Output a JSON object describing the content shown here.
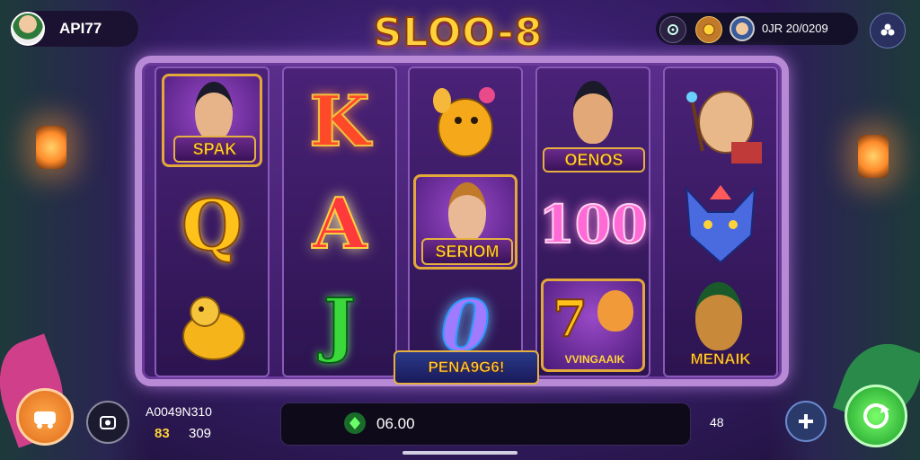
{
  "player": {
    "name": "API77"
  },
  "game": {
    "title": "SLOO-8"
  },
  "header": {
    "balance": "0JR 20/0209"
  },
  "reels": [
    {
      "symbols": [
        "SPAK",
        "Q",
        "golden-seahorse"
      ]
    },
    {
      "symbols": [
        "K",
        "A",
        "J"
      ]
    },
    {
      "symbols": [
        "golden-deer",
        "SERIOM",
        "0"
      ]
    },
    {
      "symbols": [
        "OENOS",
        "100",
        "VVINGAAIK"
      ]
    },
    {
      "symbols": [
        "lion-wizard",
        "rainbow-wolf",
        "MENAIK"
      ]
    }
  ],
  "labels": {
    "spak": "SPAK",
    "oenos": "OENOS",
    "seriom": "SERIOM",
    "menaik": "MENAIK",
    "vvingaaik": "VVINGAAIK",
    "pena": "PENA9G6!"
  },
  "letters": {
    "k": "K",
    "q": "Q",
    "a": "A",
    "j": "J",
    "zero": "0",
    "hundred": "100",
    "seven": "7"
  },
  "footer": {
    "account_code": "A0049N310",
    "stat_a": "83",
    "stat_b": "309",
    "bet_value": "06.00",
    "right_value": "48"
  },
  "icons": {
    "settings": "gear-icon",
    "coin": "coin-icon",
    "menu": "flower-icon",
    "shop": "cart-icon",
    "autoplay": "refresh-icon",
    "bet": "gem-icon",
    "plus": "plus-icon",
    "spin": "spin-icon"
  },
  "colors": {
    "accent": "#ffd23a",
    "frame": "#b88ad6",
    "spin": "#3ac84a",
    "shop": "#f08a2a"
  }
}
